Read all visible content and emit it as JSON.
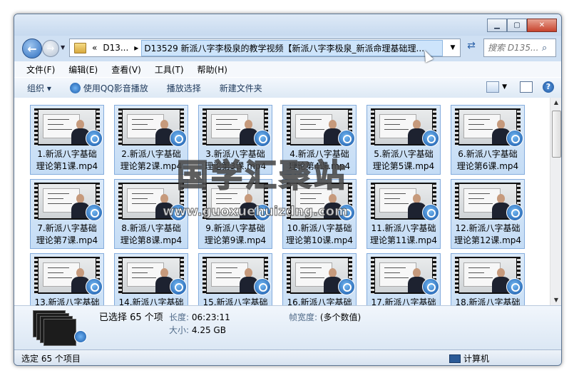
{
  "window": {
    "controls": {
      "minimize_icon": "minimize-icon",
      "maximize_icon": "maximize-icon",
      "close_icon": "close-icon"
    }
  },
  "nav": {
    "breadcrumb_prefix": "«",
    "breadcrumb_short": "D13...",
    "breadcrumb_sep": "▸",
    "path_full": "D13529 新派八字李极泉的教学视频【新派八字李极泉_新派命理基础理...",
    "search_placeholder": "搜索 D135..."
  },
  "menu": [
    "文件(F)",
    "编辑(E)",
    "查看(V)",
    "工具(T)",
    "帮助(H)"
  ],
  "commands": {
    "organize": "组织 ▾",
    "qq_play": "使用QQ影音播放",
    "play_selection": "播放选择",
    "new_folder": "新建文件夹"
  },
  "files": [
    {
      "line1": "1.新派八字基础",
      "line2": "理论第1课.mp4"
    },
    {
      "line1": "2.新派八字基础",
      "line2": "理论第2课.mp4"
    },
    {
      "line1": "3.新派八字基础",
      "line2": "理论第3课.mp4"
    },
    {
      "line1": "4.新派八字基础",
      "line2": "理论第4课.mp4"
    },
    {
      "line1": "5.新派八字基础",
      "line2": "理论第5课.mp4"
    },
    {
      "line1": "6.新派八字基础",
      "line2": "理论第6课.mp4"
    },
    {
      "line1": "7.新派八字基础",
      "line2": "理论第7课.mp4"
    },
    {
      "line1": "8.新派八字基础",
      "line2": "理论第8课.mp4"
    },
    {
      "line1": "9.新派八字基础",
      "line2": "理论第9课.mp4"
    },
    {
      "line1": "10.新派八字基础",
      "line2": "理论第10课.mp4"
    },
    {
      "line1": "11.新派八字基础",
      "line2": "理论第11课.mp4"
    },
    {
      "line1": "12.新派八字基础",
      "line2": "理论第12课.mp4"
    },
    {
      "line1": "13.新派八字基础",
      "line2": ""
    },
    {
      "line1": "14.新派八字基础",
      "line2": ""
    },
    {
      "line1": "15.新派八字基础",
      "line2": ""
    },
    {
      "line1": "16.新派八字基础",
      "line2": ""
    },
    {
      "line1": "17.新派八字基础",
      "line2": ""
    },
    {
      "line1": "18.新派八字基础",
      "line2": ""
    }
  ],
  "details": {
    "selected": "已选择 65 个项",
    "length_key": "长度:",
    "length_val": "06:23:11",
    "size_key": "大小:",
    "size_val": "4.25 GB",
    "framewidth_key": "帧宽度:",
    "framewidth_val": "(多个数值)"
  },
  "status": {
    "left": "选定 65 个项目",
    "right": "计算机"
  },
  "watermark": {
    "title": "国学汇聚站",
    "url": "www.guoxuehuizdng.com"
  }
}
